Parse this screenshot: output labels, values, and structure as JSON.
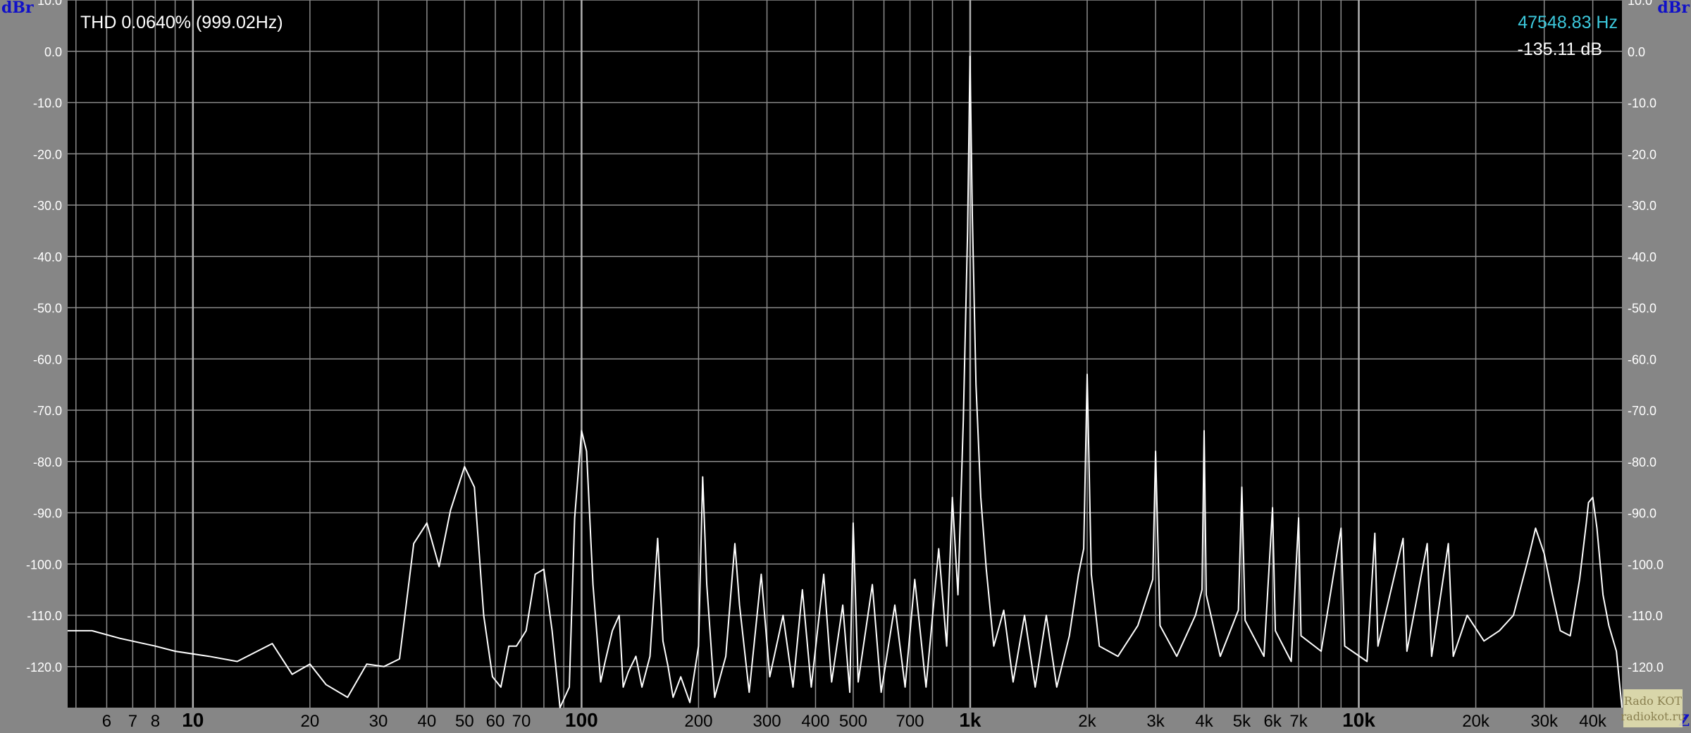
{
  "colors": {
    "panel": "#868686",
    "plot": "#000000",
    "grid": "#8c8c8c",
    "trace": "#ffffff",
    "cursor_freq": "#3cc8dc",
    "readout": "#ffffff",
    "unit": "#1010c8"
  },
  "readouts": {
    "thd": "THD 0.0640% (999.02Hz)",
    "cursor_freq": "47548.83 Hz",
    "cursor_level": "-135.11 dB"
  },
  "watermark": {
    "line1": "Rado KOT",
    "line2": "radiokot.ru"
  },
  "chart_data": {
    "type": "line",
    "x_scale": "log",
    "xlim": [
      4.76,
      47548.83
    ],
    "ylim": [
      -128,
      10
    ],
    "grid": true,
    "ylabel_left": "dBr",
    "ylabel_right": "dBr",
    "xlabel_corner": "Z",
    "y_ticks": [
      10,
      0,
      -10,
      -20,
      -30,
      -40,
      -50,
      -60,
      -70,
      -80,
      -90,
      -100,
      -110,
      -120
    ],
    "y_tick_labels": [
      "10.0",
      "0.0",
      "-10.0",
      "-20.0",
      "-30.0",
      "-40.0",
      "-50.0",
      "-60.0",
      "-70.0",
      "-80.0",
      "-90.0",
      "-100.0",
      "-110.0",
      "-120.0"
    ],
    "x_ticks": [
      {
        "value": 6,
        "label": "6",
        "major": false
      },
      {
        "value": 7,
        "label": "7",
        "major": false
      },
      {
        "value": 8,
        "label": "8",
        "major": false
      },
      {
        "value": 10,
        "label": "10",
        "major": true
      },
      {
        "value": 20,
        "label": "20",
        "major": false
      },
      {
        "value": 30,
        "label": "30",
        "major": false
      },
      {
        "value": 40,
        "label": "40",
        "major": false
      },
      {
        "value": 50,
        "label": "50",
        "major": false
      },
      {
        "value": 60,
        "label": "60",
        "major": false
      },
      {
        "value": 70,
        "label": "70",
        "major": false
      },
      {
        "value": 100,
        "label": "100",
        "major": true
      },
      {
        "value": 200,
        "label": "200",
        "major": false
      },
      {
        "value": 300,
        "label": "300",
        "major": false
      },
      {
        "value": 400,
        "label": "400",
        "major": false
      },
      {
        "value": 500,
        "label": "500",
        "major": false
      },
      {
        "value": 700,
        "label": "700",
        "major": false
      },
      {
        "value": 1000,
        "label": "1k",
        "major": true
      },
      {
        "value": 2000,
        "label": "2k",
        "major": false
      },
      {
        "value": 3000,
        "label": "3k",
        "major": false
      },
      {
        "value": 4000,
        "label": "4k",
        "major": false
      },
      {
        "value": 5000,
        "label": "5k",
        "major": false
      },
      {
        "value": 6000,
        "label": "6k",
        "major": false
      },
      {
        "value": 7000,
        "label": "7k",
        "major": false
      },
      {
        "value": 10000,
        "label": "10k",
        "major": true
      },
      {
        "value": 20000,
        "label": "20k",
        "major": false
      },
      {
        "value": 30000,
        "label": "30k",
        "major": false
      },
      {
        "value": 40000,
        "label": "40k",
        "major": false
      }
    ],
    "series": [
      {
        "points": [
          [
            4.76,
            -113
          ],
          [
            5.5,
            -113
          ],
          [
            6.5,
            -114.5
          ],
          [
            8,
            -116
          ],
          [
            9,
            -117
          ],
          [
            11,
            -118
          ],
          [
            13,
            -119
          ],
          [
            16,
            -115.5
          ],
          [
            18,
            -121.5
          ],
          [
            20,
            -119.5
          ],
          [
            22,
            -123.5
          ],
          [
            25,
            -126
          ],
          [
            28,
            -119.5
          ],
          [
            31,
            -120
          ],
          [
            34,
            -118.5
          ],
          [
            37,
            -96
          ],
          [
            40,
            -92
          ],
          [
            43,
            -100.5
          ],
          [
            46,
            -89.5
          ],
          [
            50,
            -81
          ],
          [
            53,
            -85
          ],
          [
            56,
            -110
          ],
          [
            59,
            -122
          ],
          [
            62,
            -124
          ],
          [
            65,
            -116
          ],
          [
            68,
            -116
          ],
          [
            72,
            -113
          ],
          [
            76,
            -102
          ],
          [
            80,
            -101
          ],
          [
            84,
            -113
          ],
          [
            88,
            -128
          ],
          [
            93,
            -124
          ],
          [
            96,
            -91
          ],
          [
            100,
            -74
          ],
          [
            103,
            -78
          ],
          [
            107,
            -104
          ],
          [
            112,
            -123
          ],
          [
            115,
            -119
          ],
          [
            120,
            -113
          ],
          [
            125,
            -110
          ],
          [
            128,
            -124
          ],
          [
            132,
            -121
          ],
          [
            138,
            -118
          ],
          [
            143,
            -124
          ],
          [
            150,
            -118
          ],
          [
            157,
            -95
          ],
          [
            162,
            -115
          ],
          [
            167,
            -120
          ],
          [
            172,
            -126
          ],
          [
            180,
            -122
          ],
          [
            190,
            -127
          ],
          [
            200,
            -116
          ],
          [
            205,
            -83
          ],
          [
            210,
            -104
          ],
          [
            220,
            -126
          ],
          [
            235,
            -118
          ],
          [
            248,
            -96
          ],
          [
            255,
            -108
          ],
          [
            270,
            -125
          ],
          [
            290,
            -102
          ],
          [
            305,
            -122
          ],
          [
            330,
            -110
          ],
          [
            350,
            -124
          ],
          [
            370,
            -105
          ],
          [
            390,
            -124
          ],
          [
            420,
            -102
          ],
          [
            440,
            -123
          ],
          [
            470,
            -108
          ],
          [
            490,
            -125
          ],
          [
            500,
            -92
          ],
          [
            515,
            -123
          ],
          [
            560,
            -104
          ],
          [
            590,
            -125
          ],
          [
            640,
            -108
          ],
          [
            680,
            -124
          ],
          [
            720,
            -103
          ],
          [
            770,
            -124
          ],
          [
            830,
            -97
          ],
          [
            870,
            -116
          ],
          [
            900,
            -87
          ],
          [
            930,
            -106
          ],
          [
            960,
            -72
          ],
          [
            985,
            -35
          ],
          [
            999,
            -1
          ],
          [
            1013,
            -32
          ],
          [
            1035,
            -65
          ],
          [
            1065,
            -87
          ],
          [
            1100,
            -101
          ],
          [
            1150,
            -116
          ],
          [
            1220,
            -109
          ],
          [
            1290,
            -123
          ],
          [
            1380,
            -110
          ],
          [
            1470,
            -124
          ],
          [
            1570,
            -110
          ],
          [
            1670,
            -124
          ],
          [
            1800,
            -114
          ],
          [
            1900,
            -102
          ],
          [
            1960,
            -97
          ],
          [
            2000,
            -63
          ],
          [
            2050,
            -102
          ],
          [
            2150,
            -116
          ],
          [
            2400,
            -118
          ],
          [
            2700,
            -112
          ],
          [
            2950,
            -103
          ],
          [
            3000,
            -78
          ],
          [
            3080,
            -112
          ],
          [
            3400,
            -118
          ],
          [
            3800,
            -110
          ],
          [
            3950,
            -105
          ],
          [
            4000,
            -74
          ],
          [
            4050,
            -106
          ],
          [
            4400,
            -118
          ],
          [
            4900,
            -109
          ],
          [
            5000,
            -85
          ],
          [
            5100,
            -111
          ],
          [
            5700,
            -118
          ],
          [
            6000,
            -89
          ],
          [
            6100,
            -113
          ],
          [
            6700,
            -119
          ],
          [
            7000,
            -91
          ],
          [
            7100,
            -114
          ],
          [
            8000,
            -117
          ],
          [
            9000,
            -93
          ],
          [
            9200,
            -116
          ],
          [
            10500,
            -119
          ],
          [
            11000,
            -94
          ],
          [
            11200,
            -116
          ],
          [
            13000,
            -95
          ],
          [
            13300,
            -117
          ],
          [
            15000,
            -96
          ],
          [
            15400,
            -118
          ],
          [
            17000,
            -96
          ],
          [
            17500,
            -118
          ],
          [
            19000,
            -110
          ],
          [
            21000,
            -115
          ],
          [
            23000,
            -113
          ],
          [
            25000,
            -110
          ],
          [
            27500,
            -98
          ],
          [
            28500,
            -93
          ],
          [
            30000,
            -98
          ],
          [
            31500,
            -106
          ],
          [
            33000,
            -113
          ],
          [
            35000,
            -114
          ],
          [
            37000,
            -103
          ],
          [
            38500,
            -92
          ],
          [
            39000,
            -88
          ],
          [
            40000,
            -87
          ],
          [
            41000,
            -93
          ],
          [
            42500,
            -106
          ],
          [
            44000,
            -112
          ],
          [
            46000,
            -117
          ],
          [
            47548.83,
            -128
          ]
        ]
      }
    ]
  }
}
